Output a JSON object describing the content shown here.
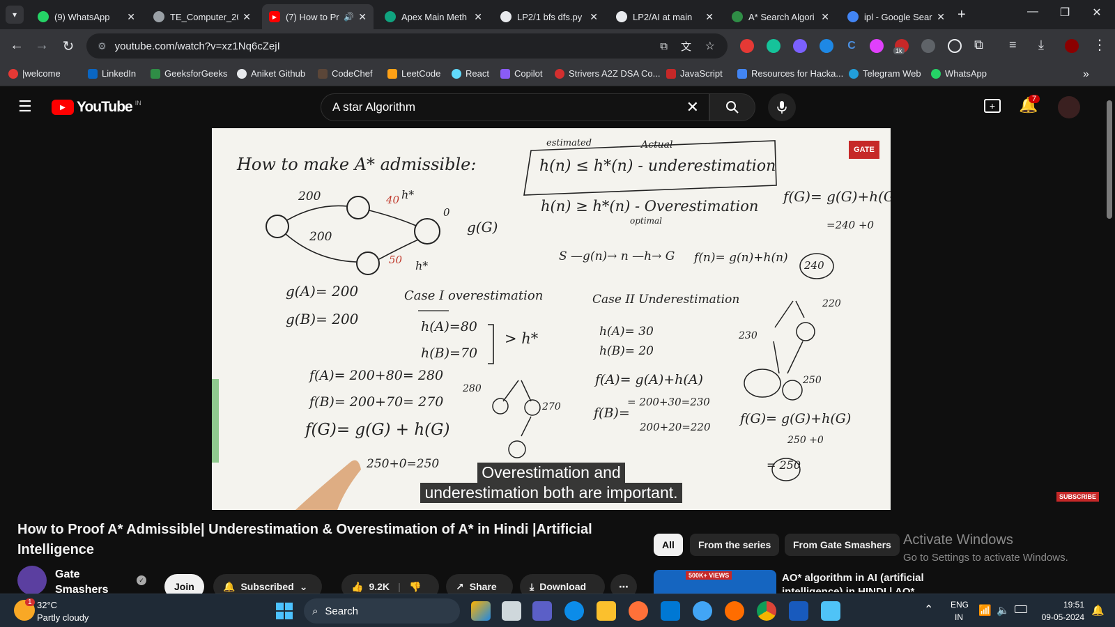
{
  "browser": {
    "tabs": [
      {
        "title": "(9) WhatsApp",
        "color": "#25d366"
      },
      {
        "title": "TE_Computer_20",
        "color": "#9aa0a6"
      },
      {
        "title": "(7) How to Pr",
        "color": "#ff0000",
        "active": true
      },
      {
        "title": "Apex Main Meth",
        "color": "#9aa0a6"
      },
      {
        "title": "LP2/1 bfs dfs.py",
        "color": "#e8eaed"
      },
      {
        "title": "LP2/AI at main",
        "color": "#e8eaed"
      },
      {
        "title": "A* Search Algori",
        "color": "#2f8d46"
      },
      {
        "title": "ipl - Google Sear",
        "color": "#4285f4"
      }
    ],
    "url": "youtube.com/watch?v=xz1Nq6cZejI",
    "ext_badge": "1k",
    "bookmarks": [
      "|welcome",
      "LinkedIn",
      "GeeksforGeeks",
      "Aniket Github",
      "CodeChef",
      "LeetCode",
      "React",
      "Copilot",
      "Strivers A2Z DSA Co...",
      "JavaScript",
      "Resources for Hacka...",
      "Telegram Web",
      "WhatsApp"
    ]
  },
  "youtube": {
    "logo_text": "YouTube",
    "region": "IN",
    "search_value": "A star Algorithm",
    "notif_count": "7",
    "caption_line1": "Overestimation and",
    "caption_line2": "underestimation both are important.",
    "video_title": "How to Proof A* Admissible| Underestimation & Overestimation of A* in Hindi |Artificial Intelligence",
    "channel_name": "Gate Smashers",
    "join_label": "Join",
    "subscribed_label": "Subscribed",
    "likes": "9.2K",
    "share_label": "Share",
    "download_label": "Download",
    "chips": [
      "All",
      "From the series",
      "From Gate Smashers"
    ],
    "rec_title": "AO* algorithm in AI (artificial intelligence) in HINDI | AO*",
    "rec_badge": "500K+ VIEWS",
    "subscribe_watermark": "SUBSCRIBE",
    "activate_title": "Activate Windows",
    "activate_sub": "Go to Settings to activate Windows."
  },
  "board": {
    "heading": "How to make A* admissible:",
    "estimated": "estimated",
    "actual": "Actual",
    "under_formula": "h(n) ≤ h*(n) - underestimation",
    "over_formula": "h(n) ≥ h*(n) - Overestimation",
    "optimal": "optimal",
    "fg_formula": "f(G)= g(G)+h(G)",
    "eq240": "=240 +0",
    "path_formula": "S —g(n)→ n —h→ G",
    "fn_formula": "f(n)= g(n)+h(n)",
    "circ240": "240",
    "ga": "g(A)= 200",
    "gb": "g(B)= 200",
    "case1": "Case I  overestimation",
    "case2": "Case II  Underestimation",
    "ha80": "h(A)=80",
    "hb70": "h(B)=70",
    "gt_hstar": "> h*",
    "ha30": "h(A)= 30",
    "hb20": "h(B)= 20",
    "fa280": "f(A)= 200+80= 280",
    "fb270": "f(B)= 200+70= 270",
    "fg_case1": "f(G)= g(G) + h(G)",
    "case1_sum": "250+0=250",
    "fa_case2": "f(A)= g(A)+h(A)",
    "fa230": "= 200+30=230",
    "fb_case2": "f(B)=",
    "fb220": "200+20=220",
    "fg_case2": "f(G)= g(G)+h(G)",
    "case2_sum": "250 +0",
    "eq250": "= 250",
    "w200a": "200",
    "w200b": "200",
    "w40": "40",
    "w50": "50",
    "hstar": "h*",
    "g_of_g": "g(G)",
    "zero": "0",
    "n280": "280",
    "n270": "270",
    "n230": "230",
    "n220": "220",
    "n250": "250",
    "brand": "GATE"
  },
  "taskbar": {
    "temp": "32°C",
    "weather": "Partly cloudy",
    "search_label": "Search",
    "lang1": "ENG",
    "lang2": "IN",
    "time": "19:51",
    "date": "09-05-2024",
    "weather_badge": "1"
  }
}
